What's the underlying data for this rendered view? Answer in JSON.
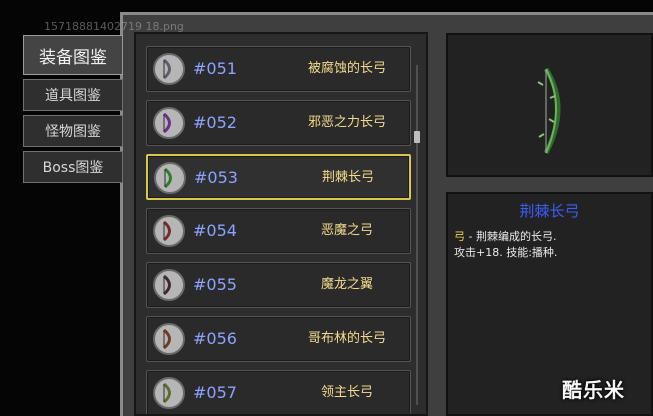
{
  "header": {
    "filename": "15718881402719 18.png"
  },
  "tabs": [
    {
      "label": "装备图鉴",
      "active": true
    },
    {
      "label": "道具图鉴",
      "active": false
    },
    {
      "label": "怪物图鉴",
      "active": false
    },
    {
      "label": "Boss图鉴",
      "active": false
    }
  ],
  "items": [
    {
      "id": "#051",
      "name": "被腐蚀的长弓",
      "icon": "bow-icon",
      "color": "#5b5f6b"
    },
    {
      "id": "#052",
      "name": "邪恶之力长弓",
      "icon": "bow-icon",
      "color": "#6a2f8a"
    },
    {
      "id": "#053",
      "name": "荆棘长弓",
      "icon": "bow-icon",
      "color": "#2f7c2f",
      "selected": true
    },
    {
      "id": "#054",
      "name": "恶魔之弓",
      "icon": "bow-icon",
      "color": "#7a2a2a"
    },
    {
      "id": "#055",
      "name": "魔龙之翼",
      "icon": "bow-icon",
      "color": "#3e2a2a"
    },
    {
      "id": "#056",
      "name": "哥布林的长弓",
      "icon": "bow-icon",
      "color": "#6e3c22"
    },
    {
      "id": "#057",
      "name": "领主长弓",
      "icon": "bow-icon",
      "color": "#5d6d2c"
    }
  ],
  "detail": {
    "title": "荆棘长弓",
    "category": "弓",
    "description": " - 荆棘编成的长弓.",
    "stats": "攻击+18. 技能:播种.",
    "preview_icon": "thorn-bow-icon"
  },
  "watermark": "酷乐米",
  "colors": {
    "accent_selected": "#d7c84a",
    "id_blue": "#8ba3ff",
    "name_gold": "#f3db8d",
    "title_blue": "#3c5cff"
  }
}
